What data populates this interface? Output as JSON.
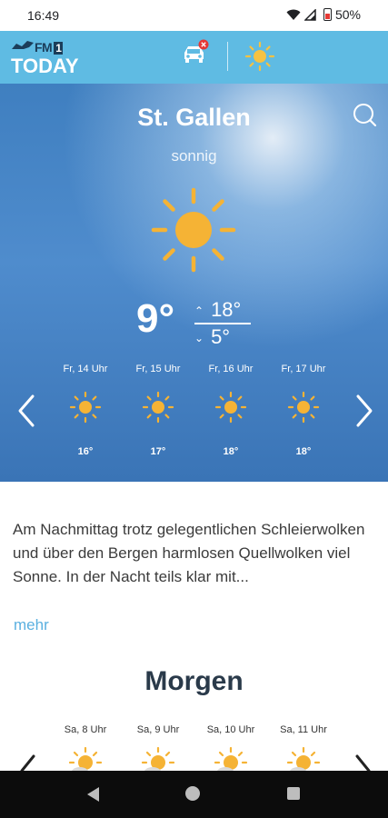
{
  "status_bar": {
    "time": "16:49",
    "battery": "50%",
    "icons": [
      "wifi-icon",
      "signal-icon",
      "battery-icon"
    ]
  },
  "header": {
    "logo_top": "FM",
    "logo_badge": "1",
    "logo_bottom": "TODAY",
    "icons": [
      "traffic-car-icon",
      "weather-sun-icon"
    ],
    "colors": {
      "bar": "#5fbbe3",
      "alert": "#e53935"
    }
  },
  "weather": {
    "city": "St. Gallen",
    "condition": "sonnig",
    "current_temp": "9°",
    "high": "18°",
    "low": "5°",
    "hourly": [
      {
        "time": "Fr, 14 Uhr",
        "temp": "16°",
        "icon": "sun-icon"
      },
      {
        "time": "Fr, 15 Uhr",
        "temp": "17°",
        "icon": "sun-icon"
      },
      {
        "time": "Fr, 16 Uhr",
        "temp": "18°",
        "icon": "sun-icon"
      },
      {
        "time": "Fr, 17 Uhr",
        "temp": "18°",
        "icon": "sun-icon"
      }
    ],
    "colors": {
      "sun": "#f5b335",
      "sky": "#3f7fc0"
    }
  },
  "description": {
    "text": "Am Nachmittag trotz gelegentlichen Schleierwolken und über den Bergen harmlosen Quellwolken viel Sonne. In der Nacht teils klar mit...",
    "more": "mehr"
  },
  "tomorrow": {
    "title": "Morgen",
    "hourly": [
      {
        "time": "Sa, 8 Uhr",
        "icon": "sun-cloud-icon"
      },
      {
        "time": "Sa, 9 Uhr",
        "icon": "sun-cloud-icon"
      },
      {
        "time": "Sa, 10 Uhr",
        "icon": "sun-cloud-icon"
      },
      {
        "time": "Sa, 11 Uhr",
        "icon": "sun-cloud-icon"
      }
    ]
  }
}
